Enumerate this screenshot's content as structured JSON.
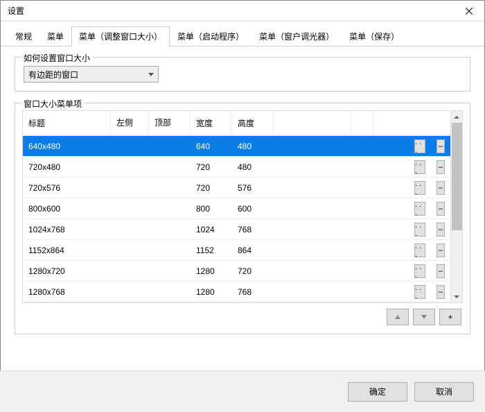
{
  "window": {
    "title": "设置"
  },
  "tabs": {
    "items": [
      {
        "label": "常规",
        "active": false
      },
      {
        "label": "菜单",
        "active": false
      },
      {
        "label": "菜单（调整窗口大小）",
        "active": true
      },
      {
        "label": "菜单（启动程序）",
        "active": false
      },
      {
        "label": "菜单（窗户调光器）",
        "active": false
      },
      {
        "label": "菜单（保存）",
        "active": false
      }
    ]
  },
  "sizer": {
    "legend": "如何设置窗口大小",
    "dropdown_value": "有边距的窗口"
  },
  "list": {
    "legend": "窗口大小菜单项",
    "columns": {
      "title": "标题",
      "left": "左侧",
      "top": "顶部",
      "width": "宽度",
      "height": "高度"
    },
    "rows": [
      {
        "title": "640x480",
        "left": "",
        "top": "",
        "width": "640",
        "height": "480",
        "selected": true
      },
      {
        "title": "720x480",
        "left": "",
        "top": "",
        "width": "720",
        "height": "480",
        "selected": false
      },
      {
        "title": "720x576",
        "left": "",
        "top": "",
        "width": "720",
        "height": "576",
        "selected": false
      },
      {
        "title": "800x600",
        "left": "",
        "top": "",
        "width": "800",
        "height": "600",
        "selected": false
      },
      {
        "title": "1024x768",
        "left": "",
        "top": "",
        "width": "1024",
        "height": "768",
        "selected": false
      },
      {
        "title": "1152x864",
        "left": "",
        "top": "",
        "width": "1152",
        "height": "864",
        "selected": false
      },
      {
        "title": "1280x720",
        "left": "",
        "top": "",
        "width": "1280",
        "height": "720",
        "selected": false
      },
      {
        "title": "1280x768",
        "left": "",
        "top": "",
        "width": "1280",
        "height": "768",
        "selected": false
      }
    ],
    "row_edit_label": ". . .",
    "row_remove_label": "–",
    "add_label": "+"
  },
  "footer": {
    "ok": "确定",
    "cancel": "取消"
  }
}
